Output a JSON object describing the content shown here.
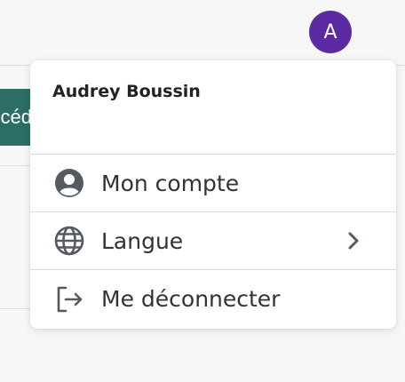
{
  "header": {
    "avatar_initial": "A",
    "avatar_color": "#5b2aa3"
  },
  "background": {
    "button_text_fragment": "céd"
  },
  "menu": {
    "user_name": "Audrey Boussin",
    "items": [
      {
        "label": "Mon compte",
        "icon": "account-circle-icon"
      },
      {
        "label": "Langue",
        "icon": "globe-icon",
        "submenu_icon": "chevron-right-icon"
      },
      {
        "label": "Me déconnecter",
        "icon": "logout-icon"
      }
    ]
  }
}
